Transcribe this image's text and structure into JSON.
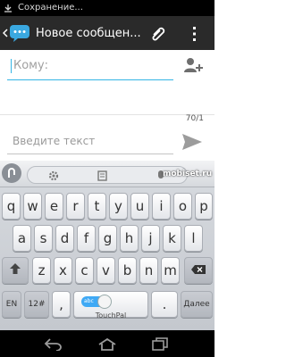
{
  "status_bar": {
    "text": "Сохранение...",
    "icon": "download-icon"
  },
  "action_bar": {
    "title": "Новое сообщен...",
    "icons": [
      "back-chevron-icon",
      "messaging-app-icon",
      "attach-icon",
      "overflow-menu-icon"
    ]
  },
  "recipient": {
    "placeholder": "Кому:",
    "icon": "add-contact-icon"
  },
  "message": {
    "placeholder": "Введите текст",
    "counter": "70/1",
    "icon": "send-icon"
  },
  "keyboard": {
    "toolbar_icons": [
      "touchpal-logo-icon",
      "settings-icon",
      "edit-icon",
      "mic-icon"
    ],
    "watermark": "mobiset.ru",
    "row1": [
      "q",
      "w",
      "e",
      "r",
      "t",
      "y",
      "u",
      "i",
      "o",
      "p"
    ],
    "row2": [
      "a",
      "s",
      "d",
      "f",
      "g",
      "h",
      "j",
      "k",
      "l"
    ],
    "row3": [
      "z",
      "x",
      "c",
      "v",
      "b",
      "n",
      "m"
    ],
    "row4": {
      "lang": "EN",
      "symbols": "12#",
      "comma": ",",
      "space_toggle": "abc",
      "space_label": "TouchPal",
      "period": ".",
      "enter": "Далее"
    }
  },
  "nav_bar": {
    "icons": [
      "back-icon",
      "home-icon",
      "recent-apps-icon"
    ]
  },
  "colors": {
    "accent": "#33b5e5",
    "action_bar": "#2a2a2a"
  }
}
